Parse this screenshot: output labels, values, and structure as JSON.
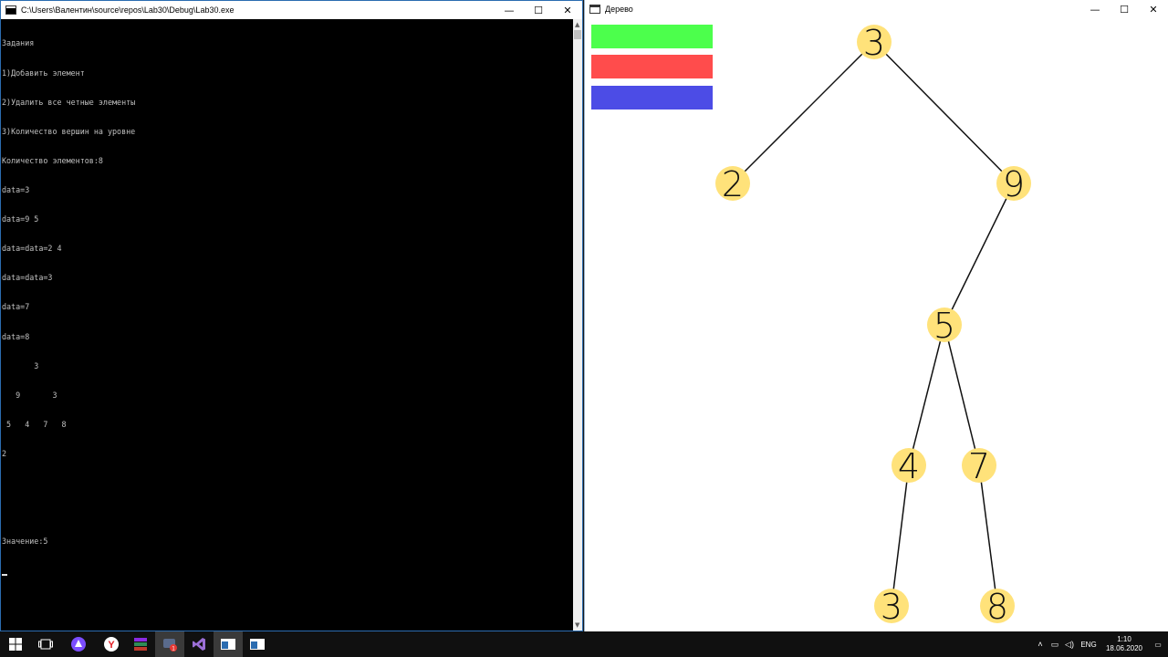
{
  "console_window": {
    "title": "C:\\Users\\Валентин\\source\\repos\\Lab30\\Debug\\Lab30.exe",
    "lines": [
      "Задания",
      "1)Добавить элемент",
      "2)Удалить все четные элементы",
      "3)Количество вершин на уровне",
      "Количество элементов:8",
      "data=3",
      "data=9 5",
      "data=data=2 4",
      "data=data=3",
      "data=7",
      "data=8",
      "       3",
      "   9       3",
      " 5   4   7   8",
      "2",
      "",
      "",
      "",
      "Значение:5"
    ]
  },
  "tree_window": {
    "title": "Дерево",
    "legend_colors": [
      "#4cff4c",
      "#ff4c4c",
      "#4c4ce6"
    ],
    "node_color": "#ffe27a",
    "nodes": [
      {
        "id": "root",
        "value": "3"
      },
      {
        "id": "left",
        "value": "2"
      },
      {
        "id": "right",
        "value": "9"
      },
      {
        "id": "right-left",
        "value": "5"
      },
      {
        "id": "rl-left",
        "value": "4"
      },
      {
        "id": "rl-right",
        "value": "7"
      },
      {
        "id": "rll-child",
        "value": "3"
      },
      {
        "id": "rlr-child",
        "value": "8"
      }
    ]
  },
  "window_controls": {
    "minimize": "—",
    "maximize": "☐",
    "close": "✕"
  },
  "taskbar": {
    "language": "ENG",
    "time": "1:10",
    "date": "18.06.2020",
    "badge_count": "1"
  }
}
